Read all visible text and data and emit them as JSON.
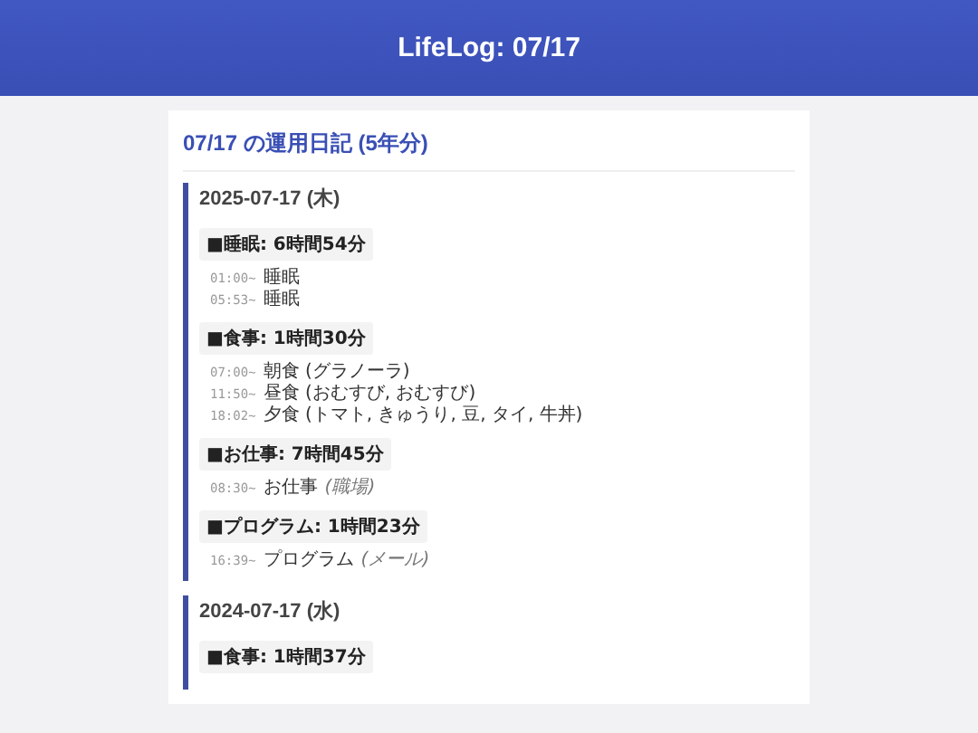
{
  "header": {
    "title": "LifeLog: 07/17"
  },
  "card": {
    "title": "07/17 の運用日記 (5年分)",
    "days": [
      {
        "date": "2025-07-17 (木)",
        "groups": [
          {
            "label": "■睡眠: 6時間54分",
            "entries": [
              {
                "time": "01:00~",
                "text": "睡眠"
              },
              {
                "time": "05:53~",
                "text": "睡眠"
              }
            ]
          },
          {
            "label": "■食事: 1時間30分",
            "entries": [
              {
                "time": "07:00~",
                "text": "朝食 (グラノーラ)"
              },
              {
                "time": "11:50~",
                "text": "昼食 (おむすび, おむすび)"
              },
              {
                "time": "18:02~",
                "text": "夕食 (トマト, きゅうり, 豆, タイ, 牛丼)"
              }
            ]
          },
          {
            "label": "■お仕事: 7時間45分",
            "entries": [
              {
                "time": "08:30~",
                "text": "お仕事",
                "note": "(職場)"
              }
            ]
          },
          {
            "label": "■プログラム: 1時間23分",
            "entries": [
              {
                "time": "16:39~",
                "text": "プログラム",
                "note": "(メール)"
              }
            ]
          }
        ]
      },
      {
        "date": "2024-07-17 (水)",
        "groups": [
          {
            "label": "■食事: 1時間37分"
          }
        ]
      }
    ]
  }
}
